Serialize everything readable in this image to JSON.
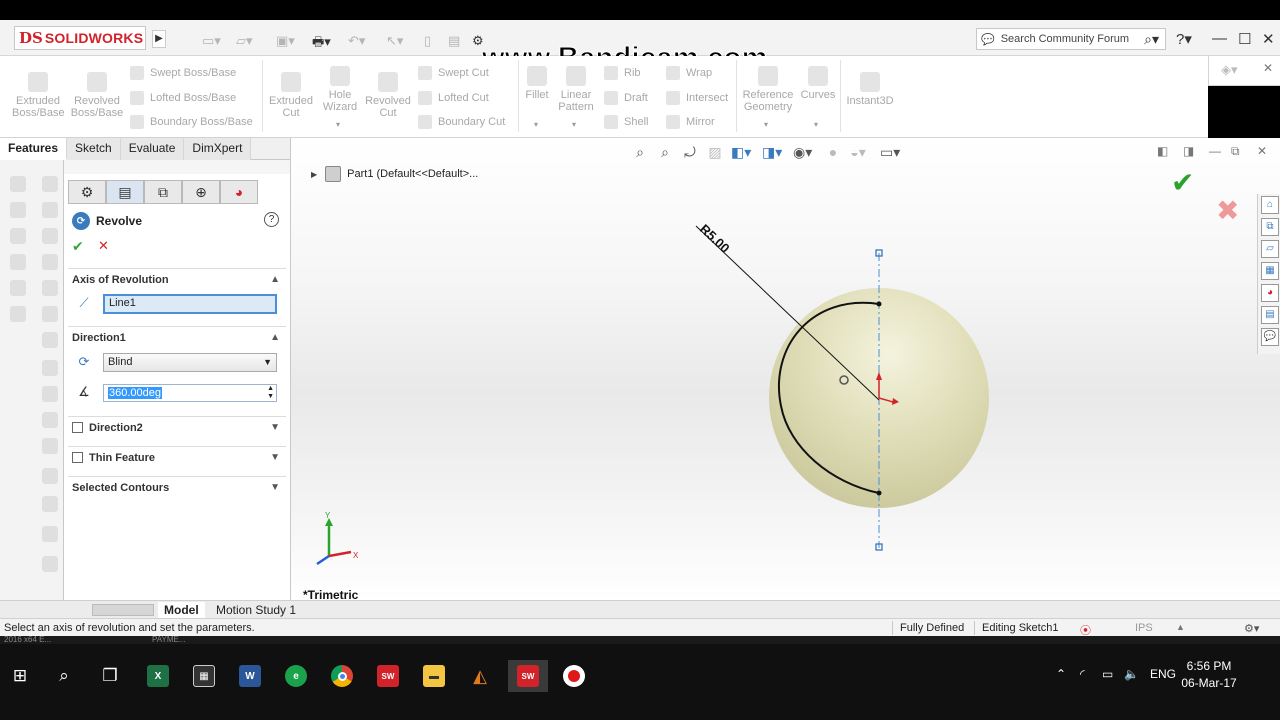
{
  "app": {
    "logo_ds": "DS",
    "logo_text": "SOLIDWORKS",
    "watermark": "www.Bandicam.com"
  },
  "search": {
    "placeholder": "Search Community Forum"
  },
  "ribbon": {
    "extruded_boss": "Extruded Boss/Base",
    "revolved_boss": "Revolved Boss/Base",
    "swept_boss": "Swept Boss/Base",
    "lofted_boss": "Lofted Boss/Base",
    "boundary_boss": "Boundary Boss/Base",
    "extruded_cut": "Extruded Cut",
    "hole_wizard": "Hole Wizard",
    "revolved_cut": "Revolved Cut",
    "swept_cut": "Swept Cut",
    "lofted_cut": "Lofted Cut",
    "boundary_cut": "Boundary Cut",
    "fillet": "Fillet",
    "linear_pattern": "Linear Pattern",
    "rib": "Rib",
    "draft": "Draft",
    "shell": "Shell",
    "wrap": "Wrap",
    "intersect": "Intersect",
    "mirror": "Mirror",
    "reference_geometry": "Reference Geometry",
    "curves": "Curves",
    "instant3d": "Instant3D"
  },
  "tabs": [
    "Features",
    "Sketch",
    "Evaluate",
    "DimXpert"
  ],
  "property_manager": {
    "title": "Revolve",
    "axis_section": "Axis of Revolution",
    "axis_value": "Line1",
    "direction1": "Direction1",
    "end_condition": "Blind",
    "angle": "360.00deg",
    "direction2": "Direction2",
    "thin_feature": "Thin Feature",
    "selected_contours": "Selected Contours"
  },
  "graphics": {
    "tree_label": "Part1  (Default<<Default>...",
    "dimension": "R5.00",
    "view_name": "*Trimetric",
    "triad_y": "Y",
    "triad_x": "X"
  },
  "bottom_tabs": [
    "Model",
    "Motion Study 1"
  ],
  "status": {
    "message": "Select an axis of revolution and set the parameters.",
    "defined": "Fully Defined",
    "editing": "Editing Sketch1",
    "units": "IPS"
  },
  "taskfrag": [
    "2016 x64 E...",
    "PAYME..."
  ],
  "taskbar": {
    "language": "ENG",
    "time": "6:56 PM",
    "date": "06-Mar-17",
    "sw_badge": "SW\n2016"
  },
  "colors": {
    "sphere": "#dedcb5",
    "accent_red": "#d2232a",
    "ok_green": "#2ea02e",
    "axis_blue": "#4a8fd8"
  }
}
